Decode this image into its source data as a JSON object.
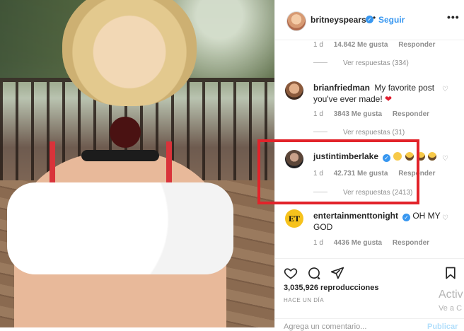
{
  "post": {
    "author": "britneyspears",
    "follow_label": "Seguir",
    "separator": "•"
  },
  "comments": [
    {
      "meta": {
        "age": "1 d",
        "likes": "14.842 Me gusta",
        "reply": "Responder"
      },
      "view_replies": "Ver respuestas (334)"
    },
    {
      "username": "brianfriedman",
      "text": "My favorite post you've ever made!",
      "meta": {
        "age": "1 d",
        "likes": "3843 Me gusta",
        "reply": "Responder"
      },
      "view_replies": "Ver respuestas (31)"
    },
    {
      "username": "justintimberlake",
      "meta": {
        "age": "1 d",
        "likes": "42.731 Me gusta",
        "reply": "Responder"
      },
      "view_replies": "Ver respuestas (2413)"
    },
    {
      "username": "entertainmenttonight",
      "text": "OH MY GOD",
      "meta": {
        "age": "1 d",
        "likes": "4436 Me gusta",
        "reply": "Responder"
      }
    }
  ],
  "et_logo_text": "ET",
  "stats": {
    "views": "3,035,926 reproducciones",
    "time_ago": "HACE UN DÍA"
  },
  "add_comment": {
    "placeholder": "Agrega un comentario...",
    "post_label": "Publicar"
  },
  "watermark": {
    "line1": "Activ",
    "line2": "Ve a C"
  },
  "colors": {
    "accent": "#3897f0",
    "highlight": "#e2232a",
    "text_muted": "#8e8e8e"
  },
  "icons": [
    "more-icon",
    "heart-icon",
    "comment-icon",
    "share-icon",
    "bookmark-icon",
    "verified-icon"
  ]
}
